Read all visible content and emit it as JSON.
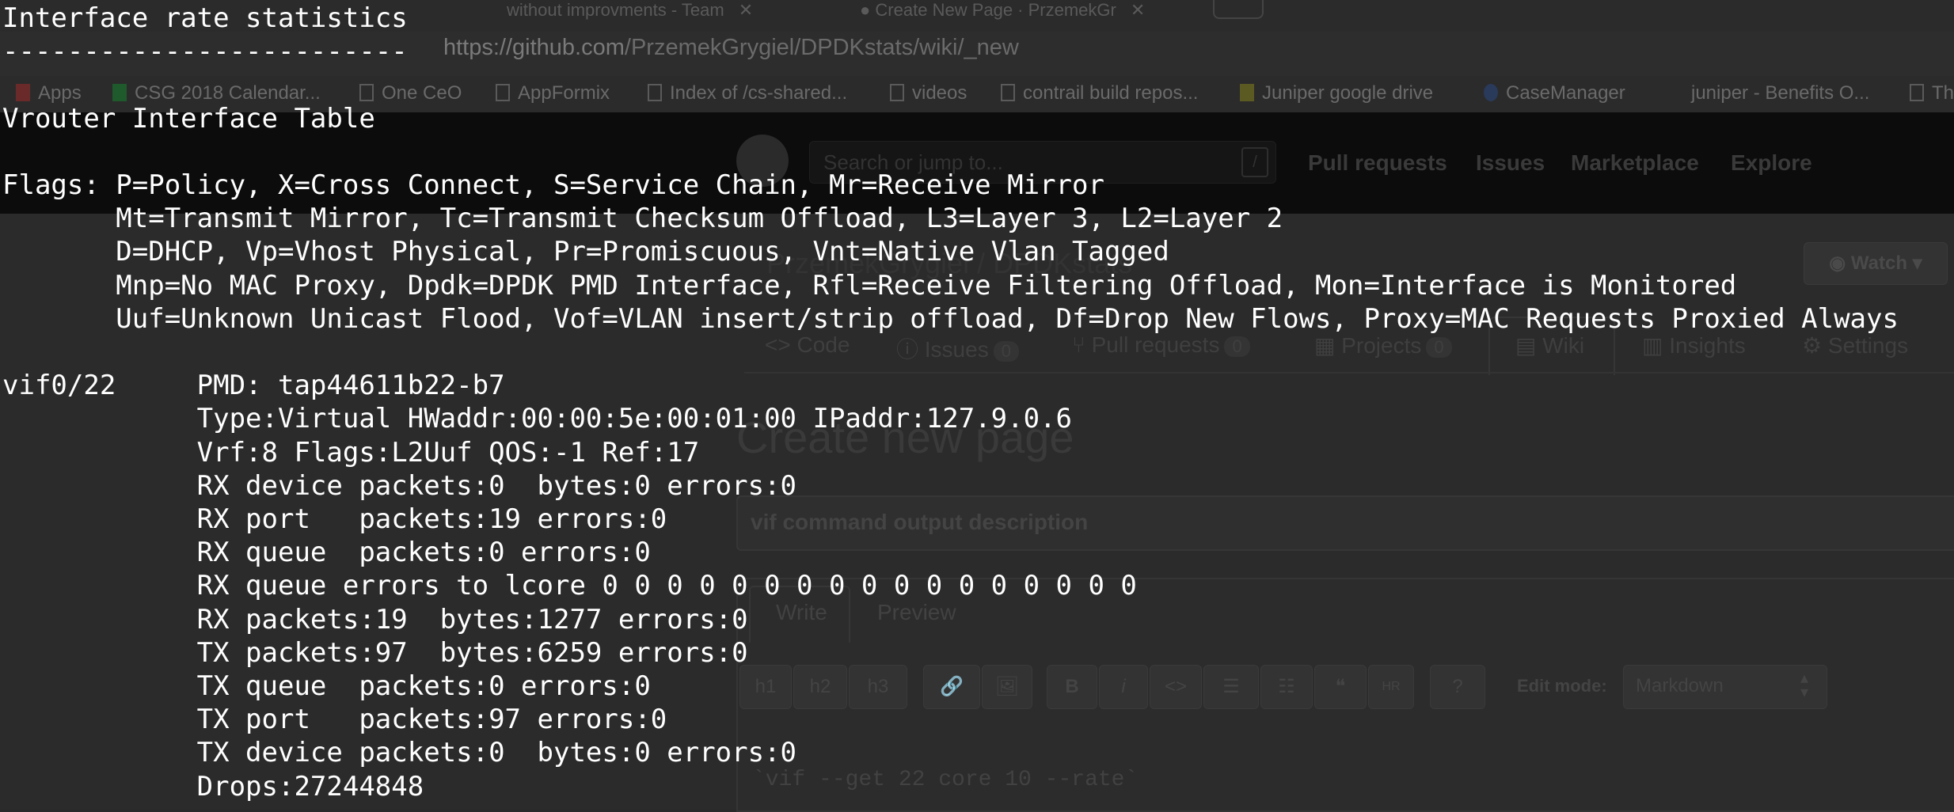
{
  "browser": {
    "tabs": [
      {
        "label": "without improvments - Team"
      },
      {
        "label": "Create New Page · PrzemekGr"
      }
    ],
    "url": {
      "domain": "https://github.com",
      "path": "/PrzemekGrygiel/DPDKstats/wiki/_new"
    },
    "bookmarks": [
      {
        "label": "Apps",
        "icon": "apps-grid-icon"
      },
      {
        "label": "CSG 2018 Calendar...",
        "icon": "sheets-icon"
      },
      {
        "label": "One CeO",
        "icon": "page-icon"
      },
      {
        "label": "AppFormix",
        "icon": "page-icon"
      },
      {
        "label": "Index of /cs-shared...",
        "icon": "page-icon"
      },
      {
        "label": "videos",
        "icon": "page-icon"
      },
      {
        "label": "contrail build repos...",
        "icon": "page-icon"
      },
      {
        "label": "Juniper google drive",
        "icon": "drive-icon"
      },
      {
        "label": "CaseManager",
        "icon": "globe-icon"
      },
      {
        "label": "juniper - Benefits O...",
        "icon": "page-icon"
      },
      {
        "label": "Th",
        "icon": "page-icon"
      }
    ]
  },
  "github": {
    "search_placeholder": "Search or jump to...",
    "nav": [
      "Pull requests",
      "Issues",
      "Marketplace",
      "Explore"
    ],
    "repo_title": "PrzemekGrygiel / DPDKstats",
    "watch_label": "Watch",
    "repo_tabs": [
      {
        "label": "Code",
        "count": ""
      },
      {
        "label": "Issues",
        "count": "0"
      },
      {
        "label": "Pull requests",
        "count": "0"
      },
      {
        "label": "Projects",
        "count": "0"
      },
      {
        "label": "Wiki",
        "count": ""
      },
      {
        "label": "Insights",
        "count": ""
      },
      {
        "label": "Settings",
        "count": ""
      }
    ],
    "page_heading": "Create new page",
    "title_value": "vif command output description",
    "editor_tabs": [
      "Write",
      "Preview"
    ],
    "toolbar": [
      "h1",
      "h2",
      "h3",
      "🔗",
      "🖼",
      "B",
      "i",
      "<>",
      "☰",
      "☷",
      "❝",
      "HR",
      "?"
    ],
    "edit_mode_label": "Edit mode:",
    "edit_mode_value": "Markdown",
    "editor_content": "`vif --get 22 core 10 --rate`"
  },
  "terminal": {
    "lines": [
      "Interface rate statistics",
      "-------------------------",
      "",
      "Vrouter Interface Table",
      "",
      "Flags: P=Policy, X=Cross Connect, S=Service Chain, Mr=Receive Mirror",
      "       Mt=Transmit Mirror, Tc=Transmit Checksum Offload, L3=Layer 3, L2=Layer 2",
      "       D=DHCP, Vp=Vhost Physical, Pr=Promiscuous, Vnt=Native Vlan Tagged",
      "       Mnp=No MAC Proxy, Dpdk=DPDK PMD Interface, Rfl=Receive Filtering Offload, Mon=Interface is Monitored",
      "       Uuf=Unknown Unicast Flood, Vof=VLAN insert/strip offload, Df=Drop New Flows, Proxy=MAC Requests Proxied Always",
      "",
      "vif0/22     PMD: tap44611b22-b7",
      "            Type:Virtual HWaddr:00:00:5e:00:01:00 IPaddr:127.9.0.6",
      "            Vrf:8 Flags:L2Uuf QOS:-1 Ref:17",
      "            RX device packets:0  bytes:0 errors:0",
      "            RX port   packets:19 errors:0",
      "            RX queue  packets:0 errors:0",
      "            RX queue errors to lcore 0 0 0 0 0 0 0 0 0 0 0 0 0 0 0 0 0",
      "            RX packets:19  bytes:1277 errors:0",
      "            TX packets:97  bytes:6259 errors:0",
      "            TX queue  packets:0 errors:0",
      "            TX port   packets:97 errors:0",
      "            TX device packets:0  bytes:0 errors:0",
      "            Drops:27244848"
    ]
  }
}
